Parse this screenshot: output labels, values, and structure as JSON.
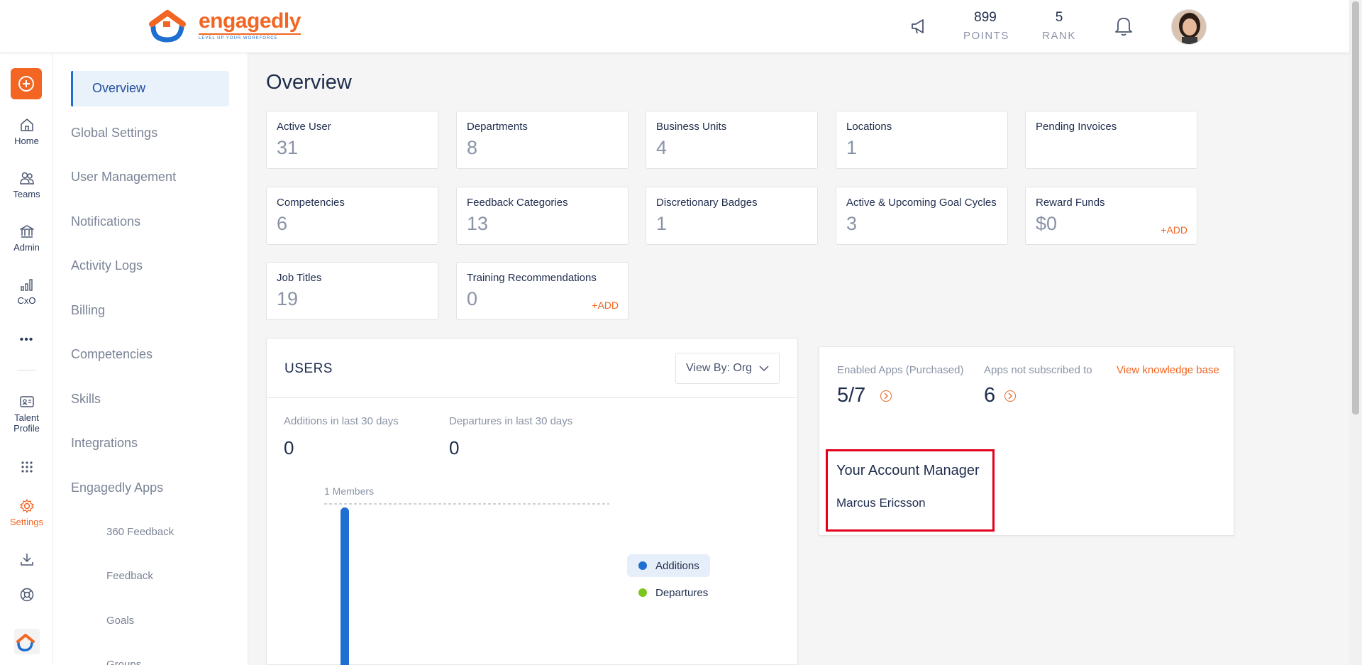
{
  "header": {
    "brand": "engagedly",
    "brand_tagline": "LEVEL UP YOUR WORKFORCE",
    "points_value": "899",
    "points_label": "POINTS",
    "rank_value": "5",
    "rank_label": "RANK",
    "icons": [
      "megaphone-icon",
      "bell-icon"
    ]
  },
  "rail": {
    "items": [
      {
        "label": "Home",
        "icon": "home-icon"
      },
      {
        "label": "Teams",
        "icon": "teams-icon"
      },
      {
        "label": "Admin",
        "icon": "admin-icon"
      },
      {
        "label": "CxO",
        "icon": "chart-icon"
      },
      {
        "label": "Talent Profile",
        "icon": "id-card-icon"
      },
      {
        "label": "Settings",
        "icon": "gear-icon"
      }
    ],
    "active_color": "#f26522"
  },
  "nav": {
    "items": [
      "Overview",
      "Global Settings",
      "User Management",
      "Notifications",
      "Activity Logs",
      "Billing",
      "Competencies",
      "Skills",
      "Integrations",
      "Engagedly Apps"
    ],
    "sub_items": [
      "360 Feedback",
      "Feedback",
      "Goals",
      "Groups"
    ]
  },
  "main": {
    "title": "Overview",
    "cards": [
      {
        "label": "Active User",
        "value": "31"
      },
      {
        "label": "Departments",
        "value": "8"
      },
      {
        "label": "Business Units",
        "value": "4"
      },
      {
        "label": "Locations",
        "value": "1"
      },
      {
        "label": "Pending Invoices",
        "value": ""
      },
      {
        "label": "Competencies",
        "value": "6"
      },
      {
        "label": "Feedback Categories",
        "value": "13"
      },
      {
        "label": "Discretionary Badges",
        "value": "1"
      },
      {
        "label": "Active & Upcoming Goal Cycles",
        "value": "3"
      },
      {
        "label": "Reward Funds",
        "value": "$0",
        "action": "+ADD"
      },
      {
        "label": "Job Titles",
        "value": "19"
      },
      {
        "label": "Training Recommendations",
        "value": "0",
        "action": "+ADD"
      }
    ]
  },
  "users": {
    "title": "USERS",
    "view_by": "View By: Org",
    "additions_label": "Additions in last 30 days",
    "additions_value": "0",
    "departures_label": "Departures in last 30 days",
    "departures_value": "0",
    "chart_data": {
      "type": "bar",
      "reference_line_label": "1 Members",
      "series": [
        {
          "name": "Additions",
          "color": "#1e6fd1",
          "values": [
            1
          ]
        },
        {
          "name": "Departures",
          "color": "#7cc61f",
          "values": [
            0
          ]
        }
      ]
    }
  },
  "apps": {
    "enabled_label": "Enabled Apps (Purchased)",
    "enabled_value": "5/7",
    "not_subscribed_label": "Apps not subscribed to",
    "not_subscribed_value": "6",
    "knowledge_base_link": "View knowledge base",
    "manager_heading": "Your Account Manager",
    "manager_name": "Marcus Ericsson"
  }
}
